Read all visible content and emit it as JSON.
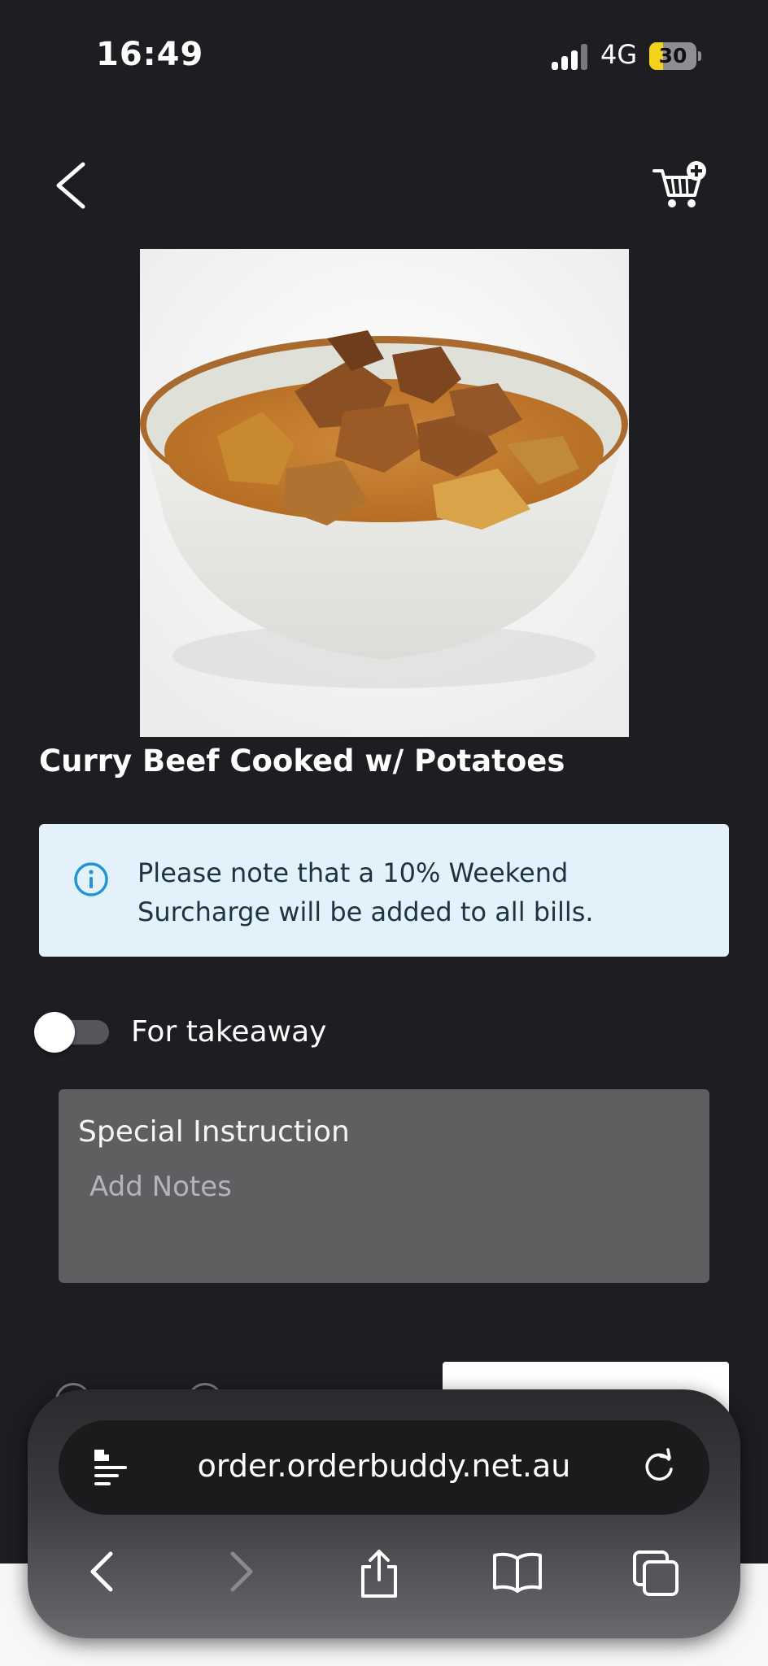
{
  "status_bar": {
    "time": "16:49",
    "network": "4G",
    "battery_percent": "30",
    "battery_level": 0.3,
    "battery_color": "#f3d21b"
  },
  "header": {
    "back_icon": "chevron-left-icon",
    "cart_icon": "cart-add-icon"
  },
  "item": {
    "title": "Curry Beef Cooked w/ Potatoes",
    "image": "curry-beef-photo"
  },
  "notice": {
    "icon": "info-icon",
    "text": "Please note that a 10% Weekend Surcharge will be added to all bills.",
    "background": "#e3f2fa",
    "icon_color": "#2196d3"
  },
  "takeaway": {
    "label": "For takeaway",
    "enabled": false
  },
  "special_instruction": {
    "label": "Special Instruction",
    "placeholder": "Add Notes",
    "value": ""
  },
  "browser": {
    "url": "order.orderbuddy.net.au",
    "icons": [
      "reader-icon",
      "reload-icon",
      "back-icon",
      "forward-icon",
      "share-icon",
      "bookmarks-icon",
      "tabs-icon"
    ]
  }
}
